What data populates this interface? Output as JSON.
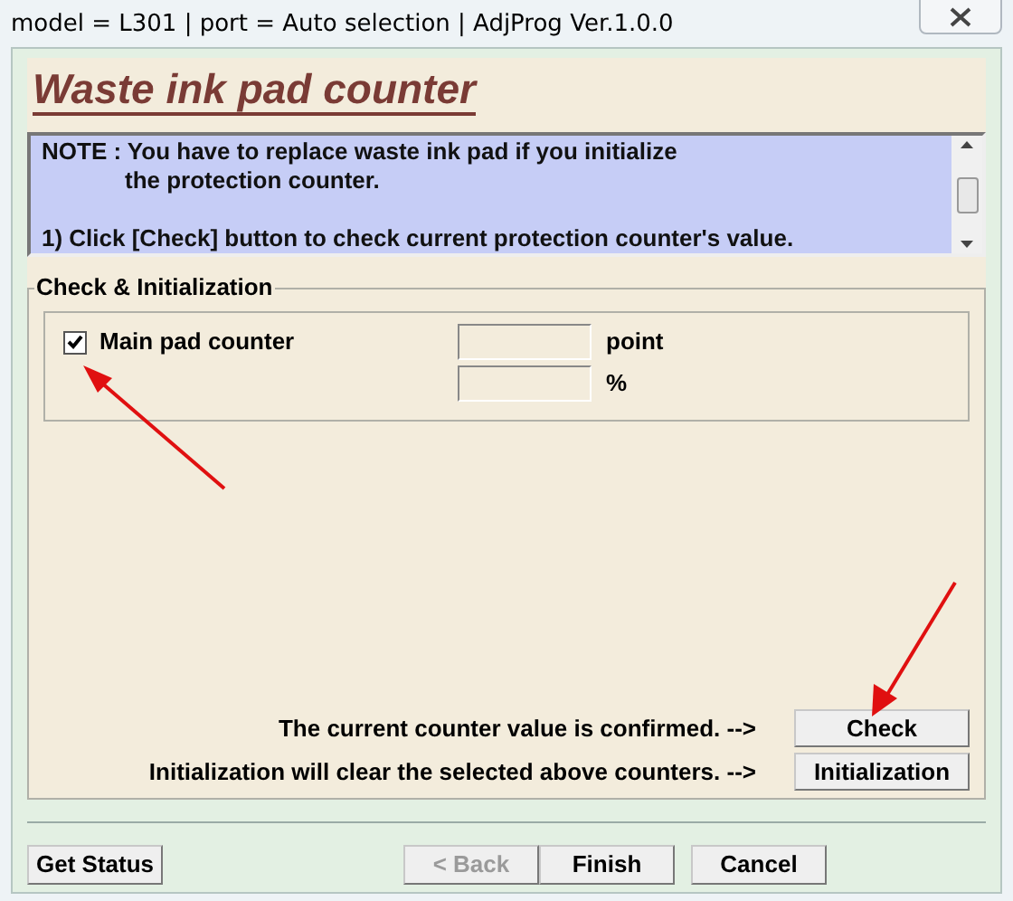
{
  "window": {
    "title": "model = L301 | port = Auto selection | AdjProg Ver.1.0.0"
  },
  "heading": "Waste ink pad counter",
  "note": {
    "lines": [
      "NOTE : You have to replace waste ink pad if you initialize",
      "the protection counter."
    ],
    "steps": [
      "1) Click [Check] button to check current protection counter's value."
    ]
  },
  "group": {
    "title": "Check & Initialization",
    "counters": [
      {
        "label": "Main pad counter",
        "checked": true,
        "units": [
          "point",
          "%"
        ]
      }
    ],
    "actions": [
      {
        "message": "The current counter value is confirmed. -->",
        "button": "Check"
      },
      {
        "message": "Initialization will clear the selected above counters. -->",
        "button": "Initialization"
      }
    ]
  },
  "footer": {
    "left": [
      {
        "label": "Get Status",
        "disabled": false
      }
    ],
    "right": [
      {
        "label": "< Back",
        "disabled": true
      },
      {
        "label": "Finish",
        "disabled": false
      },
      {
        "label": "Cancel",
        "disabled": false
      }
    ]
  }
}
